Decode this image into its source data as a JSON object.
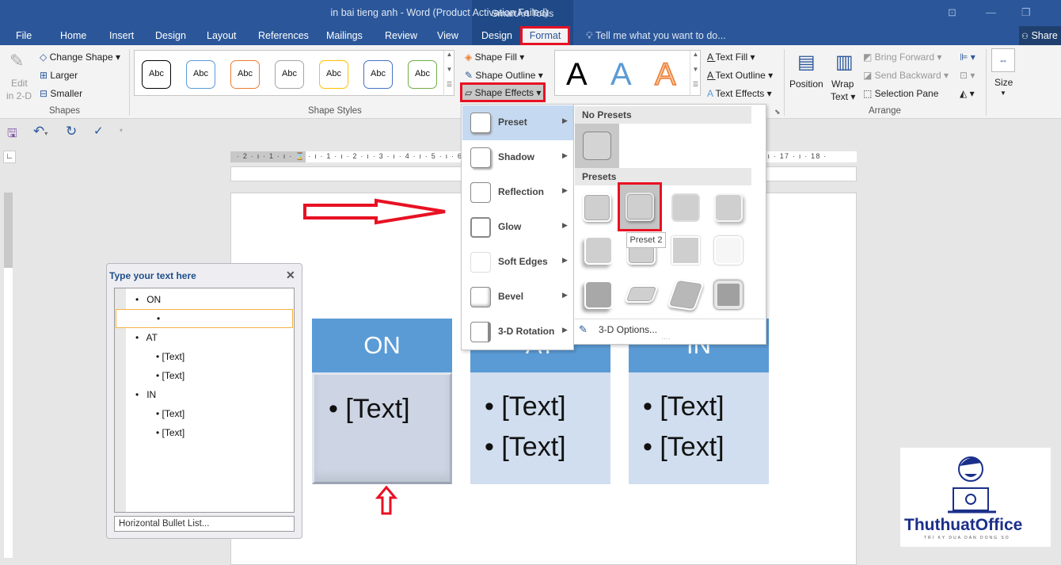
{
  "window": {
    "title": "in bai tieng anh - Word (Product Activation Failed)",
    "context_group": "SmartArt Tools"
  },
  "tabs": [
    "File",
    "Home",
    "Insert",
    "Design",
    "Layout",
    "References",
    "Mailings",
    "Review",
    "View",
    "Design",
    "Format"
  ],
  "tell_me": "Tell me what you want to do...",
  "share": "Share",
  "ribbon": {
    "shapes": {
      "edit_2d": "Edit",
      "edit_2d_2": "in 2-D",
      "change_shape": "Change Shape",
      "larger": "Larger",
      "smaller": "Smaller",
      "label": "Shapes"
    },
    "shape_styles": {
      "items": [
        "Abc",
        "Abc",
        "Abc",
        "Abc",
        "Abc",
        "Abc",
        "Abc"
      ],
      "colors": [
        "#000000",
        "#5b9bd5",
        "#ed7d31",
        "#a5a5a5",
        "#ffc000",
        "#4472c4",
        "#70ad47"
      ],
      "fill": "Shape Fill",
      "outline": "Shape Outline",
      "effects": "Shape Effects",
      "label": "Shape Styles"
    },
    "wordart": {
      "letters": [
        "A",
        "A",
        "A"
      ],
      "text_fill": "Text Fill",
      "text_outline": "Text Outline",
      "text_effects": "Text Effects"
    },
    "arrange": {
      "position": "Position",
      "wrap1": "Wrap",
      "wrap2": "Text",
      "bring_forward": "Bring Forward",
      "send_backward": "Send Backward",
      "selection_pane": "Selection Pane",
      "label": "Arrange"
    },
    "size": {
      "label": "Size"
    }
  },
  "ruler": {
    "marks": "· 2 · ı · 1 · ı · ⌛ · ı · 1 · ı · 2 · ı · 3 · ı · 4 · ı · 5 · ı · 6 · ı · 7 · ı · 8 · ı · 9 · ı · 10 · ı · 11 · ı · 12 · ı · 13 · ı · 14 · ı · 15 · ı · 16 · ı · 17 · ı · 18 ·"
  },
  "text_pane": {
    "title": "Type your text here",
    "items": [
      {
        "t": "ON",
        "lvl": 1
      },
      {
        "t": "",
        "lvl": 2
      },
      {
        "t": "AT",
        "lvl": 1
      },
      {
        "t": "[Text]",
        "lvl": 2
      },
      {
        "t": "[Text]",
        "lvl": 2
      },
      {
        "t": "IN",
        "lvl": 1
      },
      {
        "t": "[Text]",
        "lvl": 2
      },
      {
        "t": "[Text]",
        "lvl": 2
      }
    ],
    "footer": "Horizontal Bullet List..."
  },
  "smartart": [
    {
      "head": "ON",
      "bullets": [
        "[Text]"
      ]
    },
    {
      "head": "AT",
      "bullets": [
        "[Text]",
        "[Text]"
      ]
    },
    {
      "head": "IN",
      "bullets": [
        "[Text]",
        "[Text]"
      ]
    }
  ],
  "effects_menu": {
    "items": [
      "Preset",
      "Shadow",
      "Reflection",
      "Glow",
      "Soft Edges",
      "Bevel",
      "3-D Rotation"
    ]
  },
  "preset_submenu": {
    "no_presets": "No Presets",
    "presets": "Presets",
    "tooltip": "Preset 2",
    "options": "3-D Options..."
  },
  "logo": {
    "name": "ThuthuatOffice",
    "tagline": "TRI KY DUA DAN DONG SO"
  },
  "colors": {
    "word_blue": "#2b579a",
    "smartart_head": "#5b9bd5",
    "highlight_red": "#e81123"
  }
}
